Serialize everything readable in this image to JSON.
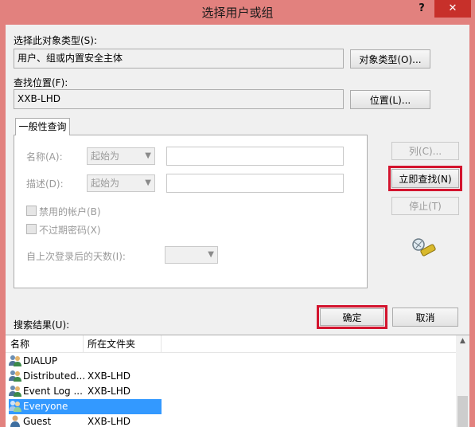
{
  "window": {
    "title": "选择用户或组",
    "help_glyph": "?",
    "close_glyph": "✕"
  },
  "object_type": {
    "label": "选择此对象类型(S):",
    "value": "用户、组或内置安全主体",
    "button": "对象类型(O)..."
  },
  "location": {
    "label": "查找位置(F):",
    "value": "XXB-LHD",
    "button": "位置(L)..."
  },
  "tab": {
    "label": "一般性查询"
  },
  "query": {
    "name_label": "名称(A):",
    "name_mode": "起始为",
    "desc_label": "描述(D):",
    "desc_mode": "起始为",
    "disabled_accounts": "禁用的帐户(B)",
    "no_expire_password": "不过期密码(X)",
    "days_since_login": "自上次登录后的天数(I):"
  },
  "side_buttons": {
    "columns": "列(C)...",
    "find_now": "立即查找(N)",
    "stop": "停止(T)"
  },
  "dialog_buttons": {
    "ok": "确定",
    "cancel": "取消"
  },
  "results": {
    "label": "搜索结果(U):",
    "columns": [
      "名称",
      "所在文件夹"
    ],
    "rows": [
      {
        "name": "DIALUP",
        "folder": "",
        "icon": "group-icon"
      },
      {
        "name": "Distributed...",
        "folder": "XXB-LHD",
        "icon": "group-icon"
      },
      {
        "name": "Event Log ...",
        "folder": "XXB-LHD",
        "icon": "group-icon"
      },
      {
        "name": "Everyone",
        "folder": "",
        "icon": "group-icon",
        "selected": true
      },
      {
        "name": "Guest",
        "folder": "XXB-LHD",
        "icon": "user-icon"
      }
    ]
  },
  "colors": {
    "titlebar": "#e2817e",
    "close": "#c7302a",
    "highlight": "#d3142e",
    "selection": "#3399ff"
  }
}
